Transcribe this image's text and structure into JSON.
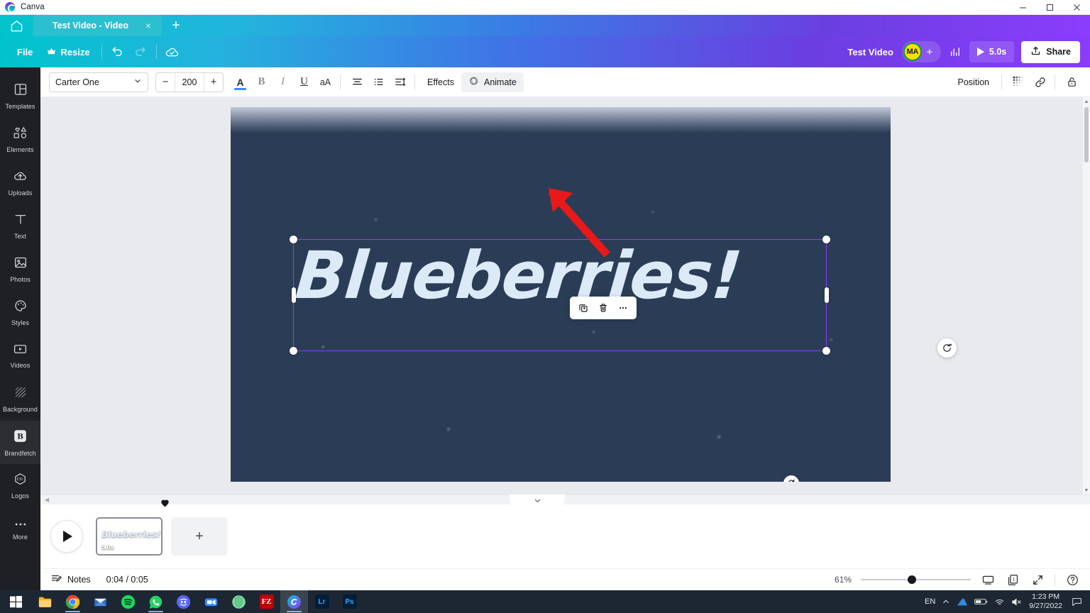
{
  "window": {
    "app_title": "Canva",
    "controls": {
      "minimize": "minimize-icon",
      "maximize": "maximize-icon",
      "close": "close-icon"
    }
  },
  "tabs": {
    "home_icon": "home-icon",
    "active_tab_label": "Test Video - Video",
    "close_label": "×",
    "new_tab_label": "+"
  },
  "appbar": {
    "file_label": "File",
    "resize_label": "Resize",
    "resize_icon": "crown-icon",
    "undo_icon": "undo-icon",
    "redo_icon": "redo-icon",
    "cloud_icon": "cloud-saved-icon",
    "doc_name": "Test Video",
    "avatar_initials": "MA",
    "invite_label": "+",
    "insights_icon": "bar-chart-icon",
    "play_duration": "5.0s",
    "share_label": "Share",
    "share_icon": "upload-icon"
  },
  "rail": {
    "items": [
      {
        "label": "Templates",
        "icon": "templates-icon",
        "active": false
      },
      {
        "label": "Elements",
        "icon": "elements-icon",
        "active": false
      },
      {
        "label": "Uploads",
        "icon": "uploads-icon",
        "active": false
      },
      {
        "label": "Text",
        "icon": "text-icon",
        "active": false
      },
      {
        "label": "Photos",
        "icon": "photos-icon",
        "active": false
      },
      {
        "label": "Styles",
        "icon": "styles-icon",
        "active": false
      },
      {
        "label": "Videos",
        "icon": "videos-icon",
        "active": false
      },
      {
        "label": "Background",
        "icon": "background-icon",
        "active": false
      },
      {
        "label": "Brandfetch",
        "icon": "brandfetch-icon",
        "active": true
      },
      {
        "label": "Logos",
        "icon": "logos-icon",
        "active": false
      },
      {
        "label": "More",
        "icon": "more-dots-icon",
        "active": false
      }
    ]
  },
  "text_toolbar": {
    "font_name": "Carter One",
    "font_dropdown_icon": "chevron-down-icon",
    "size_decrease": "−",
    "font_size": "200",
    "size_increase": "+",
    "font_color_label": "A",
    "bold_label": "B",
    "italic_label": "I",
    "underline_label": "U",
    "case_label": "aA",
    "align_icon": "align-center-icon",
    "list_icon": "bullet-list-icon",
    "spacing_icon": "line-spacing-icon",
    "effects_label": "Effects",
    "animate_label": "Animate",
    "animate_icon": "animate-icon",
    "position_label": "Position",
    "transparency_icon": "transparency-icon",
    "link_icon": "link-icon",
    "lock_icon": "lock-icon"
  },
  "canvas": {
    "headline_text": "Blueberries!",
    "headline_color": "#dceaf7",
    "selection_color": "#8b3ffb",
    "float_toolbar": {
      "duplicate_icon": "duplicate-icon",
      "delete_icon": "trash-icon",
      "more_icon": "more-horizontal-icon"
    },
    "rotate_icon": "rotate-icon",
    "magic_icon": "magic-refresh-icon",
    "annotation": {
      "type": "arrow",
      "color": "#e81919",
      "points_to": "Animate"
    }
  },
  "timeline": {
    "collapse_icon": "chevron-down-icon",
    "play_icon": "play-icon",
    "scene": {
      "title": "Blueberries!",
      "duration": "5.0s",
      "favorite_icon": "heart-icon"
    },
    "add_page_label": "+"
  },
  "statusbar": {
    "notes_icon": "notes-icon",
    "notes_label": "Notes",
    "time_display": "0:04 / 0:05",
    "zoom_percent": "61%",
    "zoom_value": 61,
    "present_icon": "present-icon",
    "pages_icon": "page-count-icon",
    "pages_count": "1",
    "fullscreen_icon": "expand-icon",
    "help_icon": "help-icon"
  },
  "taskbar": {
    "start_icon": "windows-start-icon",
    "apps": [
      {
        "name": "file-explorer",
        "glyph": "",
        "color": "#ffb515",
        "active": false
      },
      {
        "name": "google-chrome",
        "glyph": "",
        "color": "#ffffff",
        "active": false
      },
      {
        "name": "mail",
        "glyph": "",
        "color": "#2f6fd0",
        "active": false
      },
      {
        "name": "spotify",
        "glyph": "",
        "color": "#1ed760",
        "active": false
      },
      {
        "name": "whatsapp",
        "glyph": "",
        "color": "#25d366",
        "active": false
      },
      {
        "name": "discord",
        "glyph": "",
        "color": "#5865f2",
        "active": false
      },
      {
        "name": "zoom",
        "glyph": "",
        "color": "#2d8cff",
        "active": false
      },
      {
        "name": "brave",
        "glyph": "",
        "color": "#7ed9a0",
        "active": false
      },
      {
        "name": "filezilla",
        "glyph": "FZ",
        "color": "#bf0000",
        "active": false
      },
      {
        "name": "canva",
        "glyph": "",
        "color": "#00c4cc",
        "active": true
      },
      {
        "name": "lightroom",
        "glyph": "Lr",
        "color": "#001e36",
        "active": false
      },
      {
        "name": "photoshop",
        "glyph": "Ps",
        "color": "#001e36",
        "active": false
      }
    ],
    "tray": {
      "language": "EN",
      "chevron_icon": "chevron-up-icon",
      "onedrive_icon": "cloud-icon",
      "battery_icon": "battery-icon",
      "wifi_icon": "wifi-icon",
      "volume_icon": "volume-muted-icon",
      "time": "1:23 PM",
      "date": "9/27/2022",
      "notification_icon": "notification-icon"
    }
  }
}
